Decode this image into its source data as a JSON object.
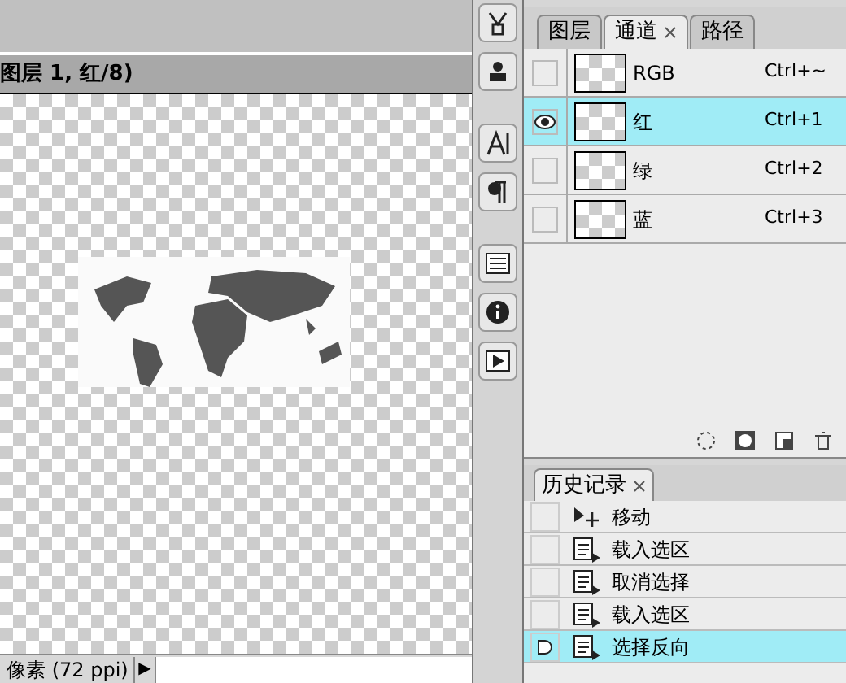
{
  "document": {
    "title": "图层 1, 红/8)",
    "status": "像素 (72 ppi)",
    "status_arrow": "▶"
  },
  "channels_panel": {
    "tabs": [
      {
        "label": "图层",
        "selected": false,
        "closable": false
      },
      {
        "label": "通道",
        "selected": true,
        "closable": true
      },
      {
        "label": "路径",
        "selected": false,
        "closable": false
      }
    ],
    "rows": [
      {
        "name": "RGB",
        "shortcut": "Ctrl+~",
        "visible": false,
        "selected": false
      },
      {
        "name": "红",
        "shortcut": "Ctrl+1",
        "visible": true,
        "selected": true
      },
      {
        "name": "绿",
        "shortcut": "Ctrl+2",
        "visible": false,
        "selected": false
      },
      {
        "name": "蓝",
        "shortcut": "Ctrl+3",
        "visible": false,
        "selected": false
      }
    ]
  },
  "history_panel": {
    "tab": "历史记录",
    "rows": [
      {
        "label": "移动",
        "kind": "move",
        "selected": false
      },
      {
        "label": "载入选区",
        "kind": "step",
        "selected": false
      },
      {
        "label": "取消选择",
        "kind": "step",
        "selected": false
      },
      {
        "label": "载入选区",
        "kind": "step",
        "selected": false
      },
      {
        "label": "选择反向",
        "kind": "step",
        "selected": true
      }
    ]
  }
}
